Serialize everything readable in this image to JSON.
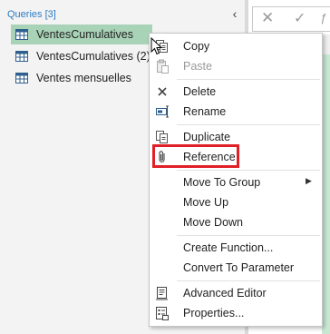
{
  "queries_pane": {
    "header": "Queries [3]",
    "collapse_icon": "chevron-left-icon",
    "items": [
      {
        "label": "VentesCumulatives",
        "selected": true,
        "icon": "table-icon"
      },
      {
        "label": "VentesCumulatives (2)",
        "selected": false,
        "icon": "table-icon"
      },
      {
        "label": "Ventes mensuelles",
        "selected": false,
        "icon": "table-icon"
      }
    ]
  },
  "formula_bar": {
    "cancel_glyph": "✕",
    "confirm_glyph": "✓",
    "fx_glyph": "ƒ"
  },
  "context_menu": {
    "items": [
      {
        "label": "Copy",
        "icon": "copy-icon",
        "enabled": true
      },
      {
        "label": "Paste",
        "icon": "paste-icon",
        "enabled": false
      },
      {
        "label": "Delete",
        "icon": "delete-icon",
        "enabled": true
      },
      {
        "label": "Rename",
        "icon": "rename-icon",
        "enabled": true
      },
      {
        "label": "Duplicate",
        "icon": "duplicate-icon",
        "enabled": true
      },
      {
        "label": "Reference",
        "icon": "reference-icon",
        "enabled": true,
        "highlighted": true
      },
      {
        "label": "Move To Group",
        "icon": "",
        "enabled": true,
        "submenu": true
      },
      {
        "label": "Move Up",
        "icon": "",
        "enabled": true
      },
      {
        "label": "Move Down",
        "icon": "",
        "enabled": true
      },
      {
        "label": "Create Function...",
        "icon": "",
        "enabled": true
      },
      {
        "label": "Convert To Parameter",
        "icon": "",
        "enabled": true
      },
      {
        "label": "Advanced Editor",
        "icon": "advanced-editor-icon",
        "enabled": true
      },
      {
        "label": "Properties...",
        "icon": "properties-icon",
        "enabled": true
      }
    ],
    "submenu_arrow": "▶"
  },
  "colors": {
    "selected_query_bg": "#a9d3b7",
    "header_text": "#2b7cc4",
    "highlight_border": "#e11f26"
  }
}
